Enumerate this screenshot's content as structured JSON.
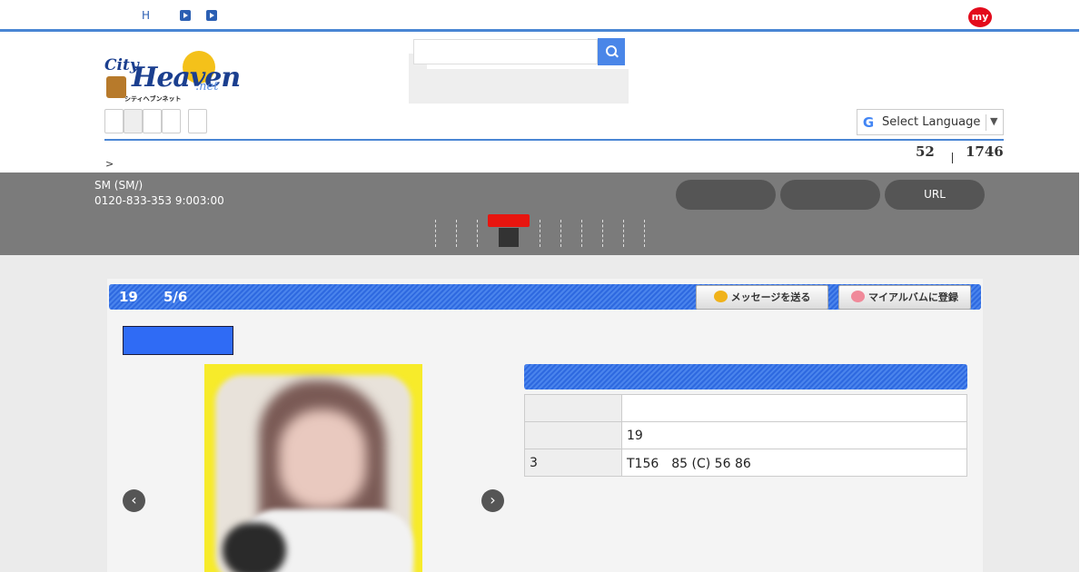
{
  "topbar": {
    "h_label": "H",
    "my_label": "my"
  },
  "search": {
    "placeholder": ""
  },
  "language": {
    "label": "Select Language",
    "arrow": "▼"
  },
  "counts": {
    "first": "52",
    "second": "1746"
  },
  "breadcrumb": ">",
  "shop": {
    "name": "SM (SM/)",
    "tel": "0120-833-353 9:003:00",
    "buttons": [
      "",
      "",
      "URL"
    ]
  },
  "profile": {
    "age": "19",
    "date": "5/6",
    "message_button": "メッセージを送る",
    "album_button": "マイアルバムに登録",
    "rows": [
      {
        "key": "",
        "value": ""
      },
      {
        "key": "",
        "value": "19"
      },
      {
        "key": "3",
        "value": "T156　85 (C)  56  86"
      }
    ]
  },
  "gallery": {
    "prev": "‹",
    "next": "›"
  },
  "colors": {
    "accent_blue": "#2e69e0",
    "topbar_line": "#4a86d4",
    "my_badge": "#e30b1c",
    "active_tab": "#e8150f",
    "graybar": "#7b7b7b"
  },
  "icons": [
    "play-icon",
    "search-icon",
    "google-g-icon",
    "chat-bubble-icon",
    "heart-icon",
    "chevron-left-icon",
    "chevron-right-icon"
  ]
}
